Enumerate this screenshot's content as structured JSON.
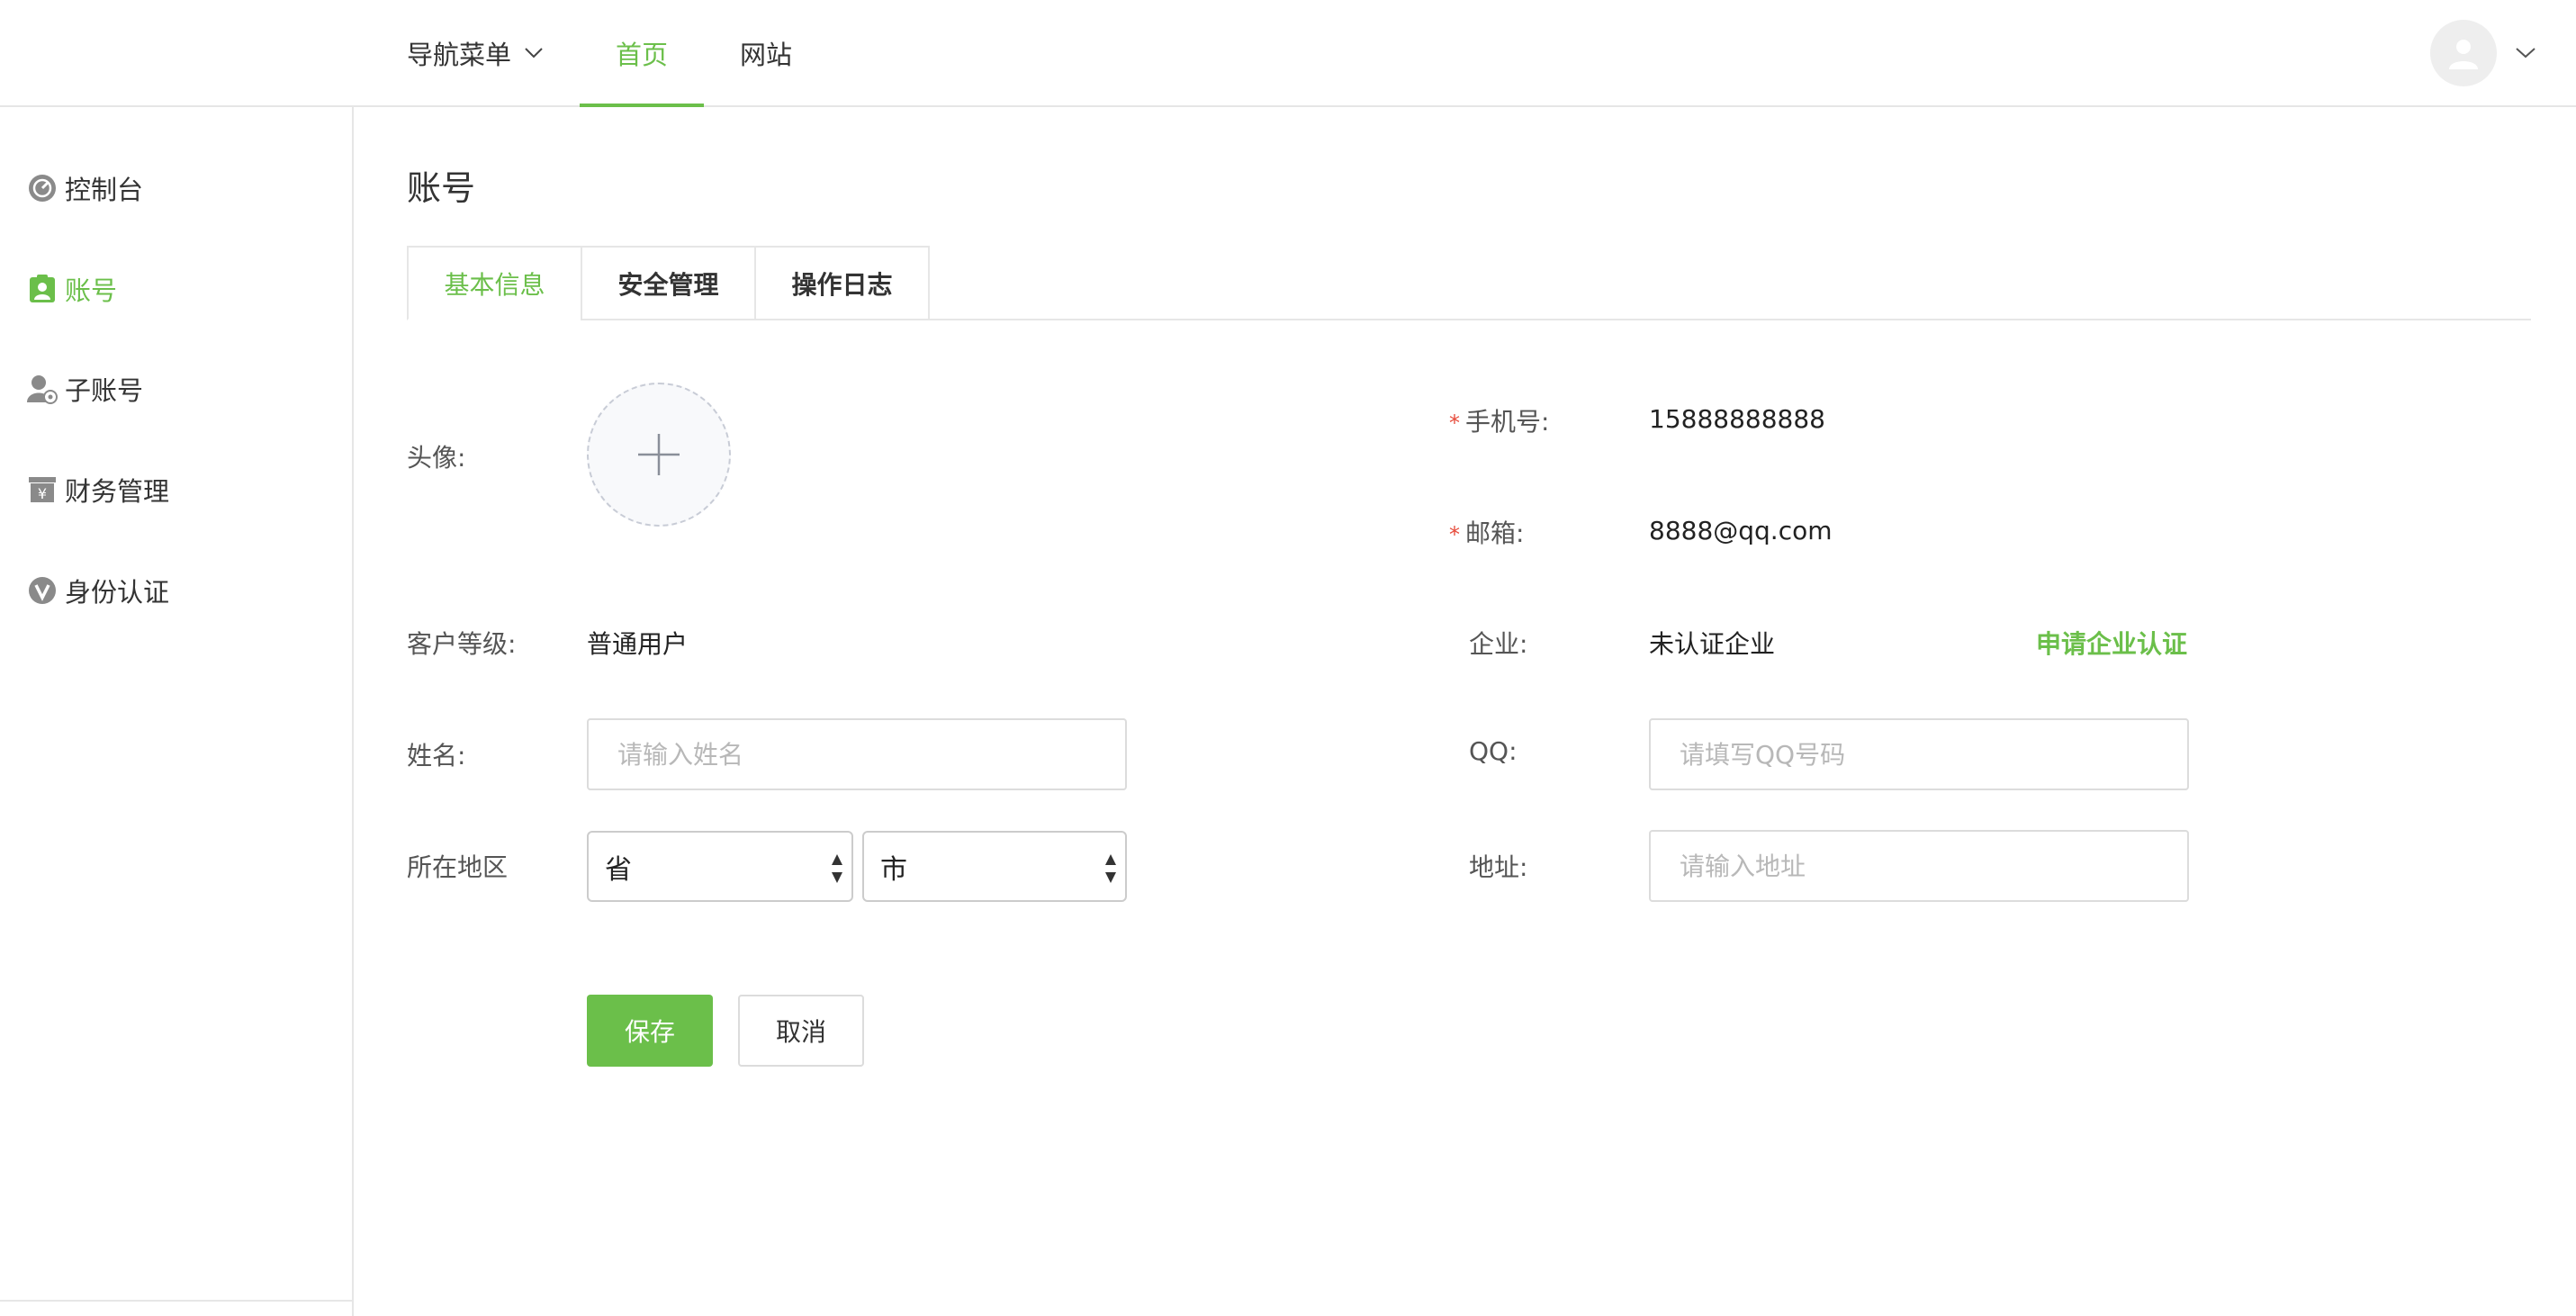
{
  "colors": {
    "accent": "#6bbf4a",
    "required": "#e74c3c",
    "border": "#e6e6e6"
  },
  "header": {
    "nav": [
      {
        "label": "导航菜单",
        "has_dropdown": true,
        "active": false
      },
      {
        "label": "首页",
        "active": true
      },
      {
        "label": "网站",
        "active": false
      }
    ],
    "user_avatar_icon": "user-icon",
    "user_dropdown_icon": "chevron-down-icon"
  },
  "sidebar": {
    "items": [
      {
        "label": "控制台",
        "icon": "dashboard-icon",
        "active": false
      },
      {
        "label": "账号",
        "icon": "account-icon",
        "active": true
      },
      {
        "label": "子账号",
        "icon": "sub-account-icon",
        "active": false
      },
      {
        "label": "财务管理",
        "icon": "finance-icon",
        "active": false
      },
      {
        "label": "身份认证",
        "icon": "verify-icon",
        "active": false
      }
    ]
  },
  "page": {
    "title": "账号",
    "tabs": [
      {
        "label": "基本信息",
        "active": true
      },
      {
        "label": "安全管理",
        "active": false
      },
      {
        "label": "操作日志",
        "active": false
      }
    ]
  },
  "form": {
    "avatar_label": "头像:",
    "avatar_upload_icon": "plus-icon",
    "level_label": "客户等级:",
    "level_value": "普通用户",
    "name_label": "姓名:",
    "name_placeholder": "请输入姓名",
    "name_value": "",
    "region_label": "所在地区",
    "province_value": "省",
    "city_value": "市",
    "phone_label": "手机号:",
    "phone_value": "15888888888",
    "email_label": "邮箱:",
    "email_value": "8888@qq.com",
    "company_label": "企业:",
    "company_value": "未认证企业",
    "company_link": "申请企业认证",
    "qq_label": "QQ:",
    "qq_placeholder": "请填写QQ号码",
    "qq_value": "",
    "address_label": "地址:",
    "address_placeholder": "请输入地址",
    "address_value": "",
    "required_mark": "*",
    "save_label": "保存",
    "cancel_label": "取消"
  }
}
